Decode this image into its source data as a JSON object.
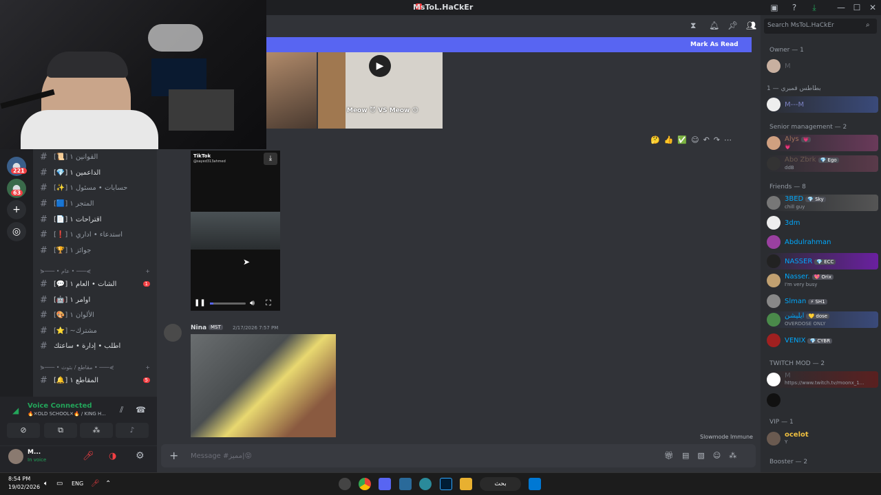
{
  "window": {
    "title": "MsToL.HaCkEr"
  },
  "mark_read": {
    "label": "Mark As Read"
  },
  "videos": {
    "top_caption": "Meow 😈 VS Meow 😊",
    "tiktok_label": "TikTok",
    "tiktok_user": "@sayed313ahmed"
  },
  "message": {
    "author": "Nina",
    "tag": "MST",
    "timestamp": "2/17/2026 7:57 PM"
  },
  "slowmode": "Slowmode Immune",
  "input": {
    "placeholder": "Message #مميز|😝"
  },
  "search": {
    "placeholder": "Search MsToL.HaCkEr"
  },
  "servers": {
    "badge1": "221",
    "badge2": "63"
  },
  "channels": [
    {
      "label": "[📜] ۱ القوانين",
      "unread": false
    },
    {
      "label": "[💎] ۱ الداعمين",
      "unread": true
    },
    {
      "label": "[✨] حسابات • مسئول ۱",
      "unread": false
    },
    {
      "label": "[🟦] ۱ المتجر",
      "unread": false
    },
    {
      "label": "[📄] ۱ اقتراحات",
      "unread": true
    },
    {
      "label": "[❗] استدعاء • اداري ۱",
      "unread": false
    },
    {
      "label": "[🏆] جوائز ۱",
      "unread": false
    }
  ],
  "category1": "⋟─── • عام • ───⋞",
  "channels2": [
    {
      "label": "[💬] الشات • العام ۱",
      "unread": true,
      "badge": "1"
    },
    {
      "label": "[🤖] اوامر ۱",
      "unread": true,
      "badge": ""
    },
    {
      "label": "[🎨] الألوان ۱",
      "unread": false,
      "badge": ""
    },
    {
      "label": "[⭐] ~مشترك",
      "unread": false,
      "badge": ""
    },
    {
      "label": "اطلب • إدارة • ساعتك",
      "unread": true,
      "badge": ""
    }
  ],
  "category2": "⋟─── • مقاطع / بثوث • ───⋞",
  "channels3": [
    {
      "label": "[🔔] ۱ المقاطع",
      "badge": "5"
    }
  ],
  "voice": {
    "status": "Voice Connected",
    "channel": "🔥✕OLD SCHOOL✕🔥 / KING H..."
  },
  "user": {
    "name": "M...",
    "status": "In voice"
  },
  "members": {
    "roles": [
      "Owner — 1",
      "بطاطس قمبري — 1",
      "Senior management — 2",
      "Friends — 8",
      "TWITCH MOD — 2",
      "VIP — 1",
      "Booster — 2"
    ],
    "owner": [
      {
        "name": "M"
      }
    ],
    "batata": [
      {
        "name": "M---M"
      }
    ],
    "senior": [
      {
        "name": "Alys",
        "tag": "💗",
        "sub": "💗"
      },
      {
        "name": "Abo Zbrk",
        "tag": "💎 Ego",
        "sub": "ddB"
      }
    ],
    "friends": [
      {
        "name": "3BED",
        "tag": "💎 Sky",
        "sub": "chill guy",
        "color": "#00a8fc"
      },
      {
        "name": "3dm",
        "tag": "",
        "sub": "",
        "color": "#00a8fc"
      },
      {
        "name": "Abdulrahman",
        "tag": "",
        "sub": "",
        "color": "#00a8fc"
      },
      {
        "name": "NASSER",
        "tag": "💎 ECC",
        "sub": "",
        "color": "#00a8fc"
      },
      {
        "name": "Nasser.",
        "tag": "💖 Orix",
        "sub": "I'm very busy",
        "color": "#00a8fc"
      },
      {
        "name": "Slman",
        "tag": "⚡ SH1",
        "sub": "",
        "color": "#00a8fc"
      },
      {
        "name": "ايليشن",
        "tag": "💛 dose",
        "sub": "OVERDOSE ONLY",
        "color": "#00a8fc"
      },
      {
        "name": "VENIX",
        "tag": "💎 CYBR",
        "sub": "",
        "color": "#00a8fc"
      }
    ],
    "twitch": [
      {
        "name": "M",
        "sub": "https://www.twitch.tv/moonx_1..."
      }
    ],
    "vip": [
      {
        "name": "ocelot",
        "sub": "Y"
      }
    ]
  },
  "taskbar": {
    "time": "8:54 PM",
    "date": "19/02/2026",
    "lang": "ENG",
    "search": "بحث"
  },
  "colors": {
    "blurple": "#5865f2",
    "red": "#f23f43",
    "green": "#23a55a"
  }
}
